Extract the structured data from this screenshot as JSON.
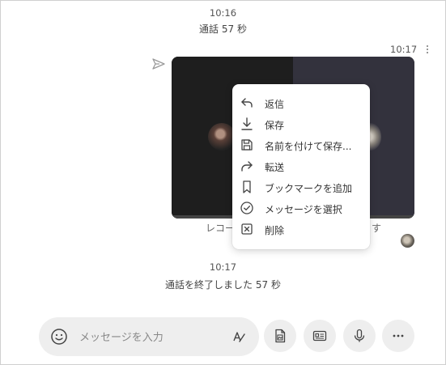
{
  "call_started": {
    "time": "10:16",
    "text": "通話 57 秒"
  },
  "message": {
    "time": "10:17"
  },
  "video_caption": {
    "left_partial": "レコー",
    "right_partial": "す"
  },
  "context_menu": {
    "items": [
      {
        "icon": "reply-icon",
        "label": "返信"
      },
      {
        "icon": "download-icon",
        "label": "保存"
      },
      {
        "icon": "save-as-icon",
        "label": "名前を付けて保存..."
      },
      {
        "icon": "forward-icon",
        "label": "転送"
      },
      {
        "icon": "bookmark-icon",
        "label": "ブックマークを追加"
      },
      {
        "icon": "check-circle-icon",
        "label": "メッセージを選択"
      },
      {
        "icon": "delete-icon",
        "label": "削除"
      }
    ]
  },
  "call_ended": {
    "time": "10:17",
    "text": "通話を終了しました 57 秒"
  },
  "composer": {
    "placeholder": "メッセージを入力"
  },
  "colors": {
    "background": "#ffffff",
    "composer_bg": "#eeeeee",
    "menu_bg": "#ffffff",
    "text": "#333333"
  }
}
